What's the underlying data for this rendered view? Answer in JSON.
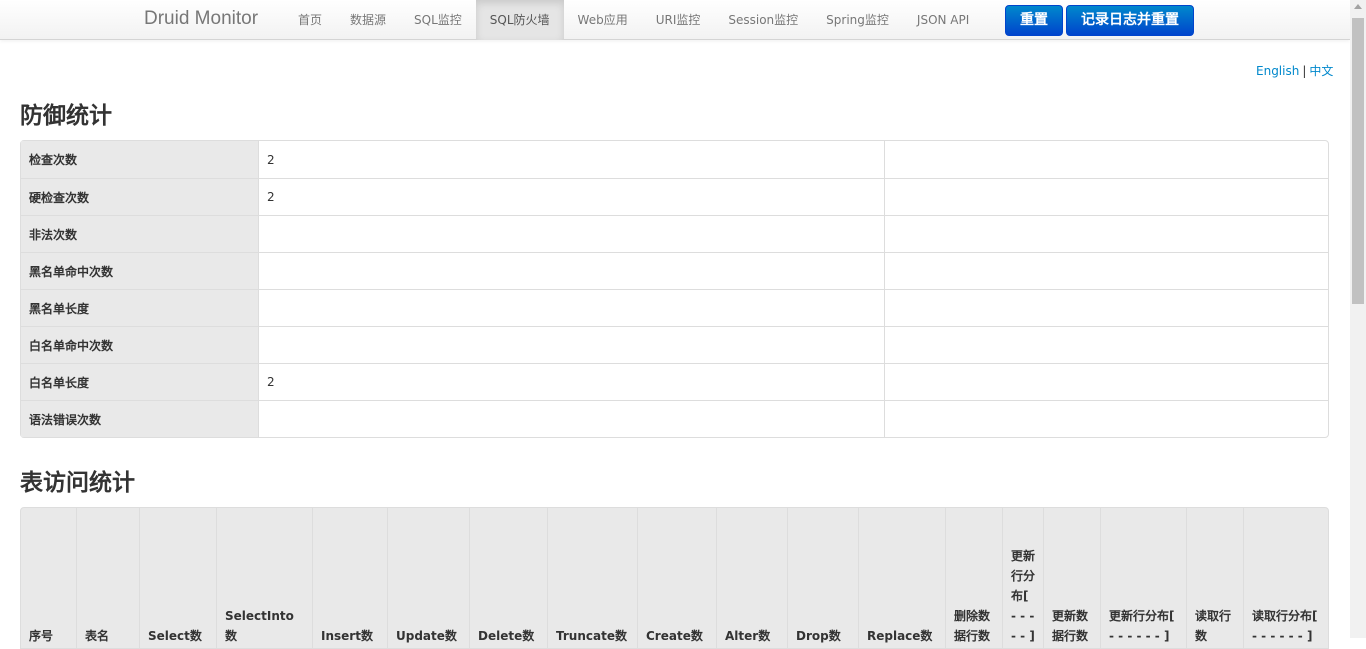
{
  "navbar": {
    "brand": "Druid Monitor",
    "items": [
      "首页",
      "数据源",
      "SQL监控",
      "SQL防火墙",
      "Web应用",
      "URI监控",
      "Session监控",
      "Spring监控",
      "JSON API"
    ],
    "active_index": 3,
    "reset_label": "重置",
    "log_reset_label": "记录日志并重置"
  },
  "lang": {
    "english": "English",
    "separator": "|",
    "chinese": "中文"
  },
  "defense": {
    "title": "防御统计",
    "rows": [
      {
        "label": "检查次数",
        "value": "2",
        "extra": ""
      },
      {
        "label": "硬检查次数",
        "value": "2",
        "extra": ""
      },
      {
        "label": "非法次数",
        "value": "",
        "extra": ""
      },
      {
        "label": "黑名单命中次数",
        "value": "",
        "extra": ""
      },
      {
        "label": "黑名单长度",
        "value": "",
        "extra": ""
      },
      {
        "label": "白名单命中次数",
        "value": "",
        "extra": ""
      },
      {
        "label": "白名单长度",
        "value": "2",
        "extra": ""
      },
      {
        "label": "语法错误次数",
        "value": "",
        "extra": ""
      }
    ]
  },
  "table_stats": {
    "title": "表访问统计",
    "headers": [
      "序号",
      "表名",
      "Select数",
      "SelectInto数",
      "Insert数",
      "Update数",
      "Delete数",
      "Truncate数",
      "Create数",
      "Alter数",
      "Drop数",
      "Replace数",
      "删除数据行数",
      "更新行分布[ - - - - - ]",
      "更新数据行数",
      "更新行分布[ - - - - - - ]",
      "读取行数",
      "读取行分布[ - - - - - - ]"
    ]
  }
}
